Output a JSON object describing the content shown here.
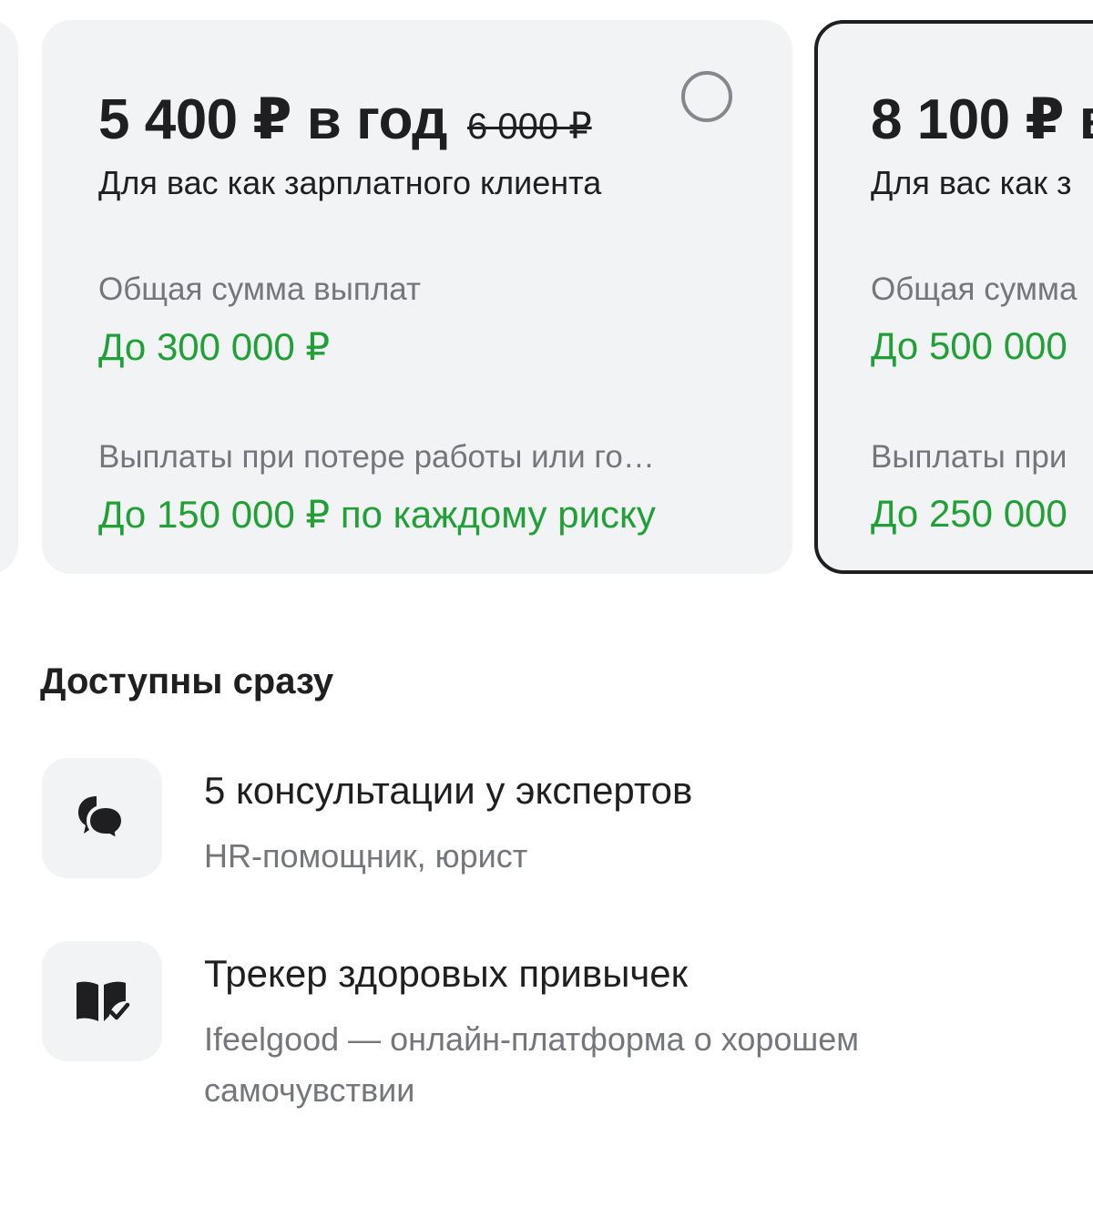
{
  "plans": [
    {
      "price": "",
      "old_price": "",
      "subtitle": "",
      "label_total": "",
      "value_total": "",
      "label_job": "",
      "value_job": ""
    },
    {
      "price": "5 400 ₽ в год",
      "old_price": "6 000 ₽",
      "subtitle": "Для вас как зарплатного клиента",
      "label_total": "Общая сумма выплат",
      "value_total": "До 300 000 ₽",
      "label_job": "Выплаты при потере работы или го…",
      "value_job": "До 150 000 ₽ по каждому риску",
      "selected": false
    },
    {
      "price": "8 100 ₽ в",
      "old_price": "",
      "subtitle": "Для вас как з",
      "label_total": "Общая сумма",
      "value_total": "До 500 000",
      "label_job": "Выплаты при",
      "value_job": "До 250 000",
      "selected": true
    }
  ],
  "section": {
    "title": "Доступны сразу"
  },
  "features": [
    {
      "icon": "chat-bubbles-icon",
      "title": "5 консультации у экспертов",
      "description": "HR-помощник, юрист"
    },
    {
      "icon": "book-check-icon",
      "title": "Трекер здоровых привычек",
      "description": "Ifeelgood — онлайн-платформа о хорошем самочувствии"
    }
  ],
  "colors": {
    "accent_green": "#21a038",
    "card_bg": "#f2f3f5",
    "muted_text": "#74767c",
    "text": "#1f1f22"
  }
}
